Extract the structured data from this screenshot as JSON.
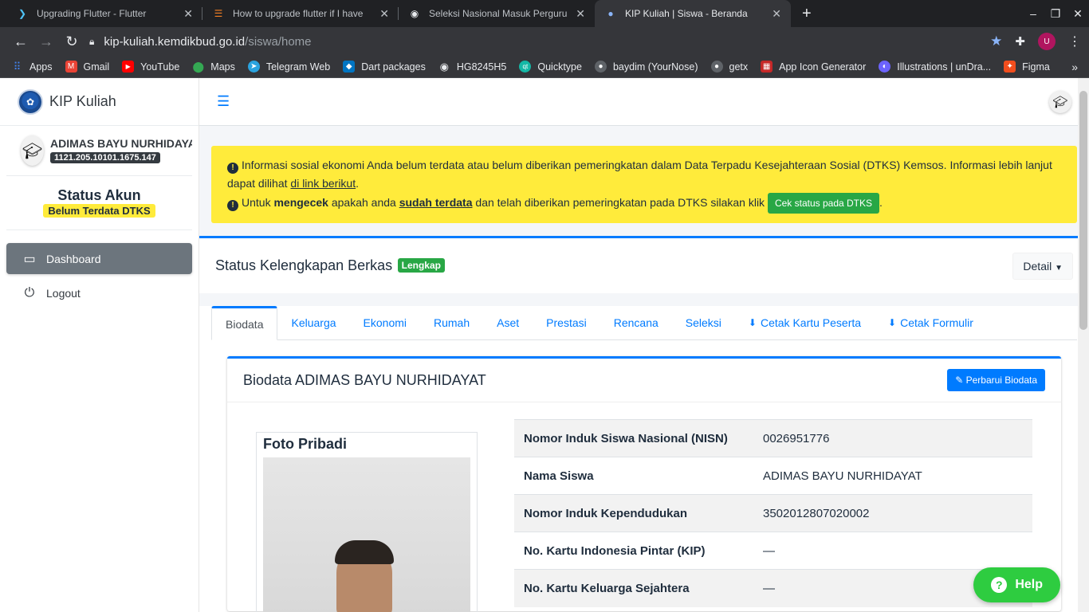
{
  "browser": {
    "tabs": [
      {
        "title": "Upgrading Flutter - Flutter",
        "icon": "flutter-icon",
        "color": "#4fc3f7"
      },
      {
        "title": "How to upgrade flutter if I have",
        "icon": "stackoverflow-icon",
        "color": "#f48024"
      },
      {
        "title": "Seleksi Nasional Masuk Perguru",
        "icon": "globe-icon",
        "color": "#e8eaed"
      },
      {
        "title": "KIP Kuliah | Siswa - Beranda",
        "icon": "kip-icon",
        "color": "#1e5bb0"
      }
    ],
    "url_host": "kip-kuliah.kemdikbud.go.id",
    "url_path": "/siswa/home",
    "profile_initial": "U",
    "bookmarks": [
      {
        "label": "Apps",
        "icon": "apps-icon",
        "color": "#4285f4"
      },
      {
        "label": "Gmail",
        "icon": "gmail-icon",
        "color": "#ea4335"
      },
      {
        "label": "YouTube",
        "icon": "youtube-icon",
        "color": "#ff0000"
      },
      {
        "label": "Maps",
        "icon": "maps-icon",
        "color": "#34a853"
      },
      {
        "label": "Telegram Web",
        "icon": "telegram-icon",
        "color": "#2aa3df"
      },
      {
        "label": "Dart packages",
        "icon": "dart-icon",
        "color": "#0175c2"
      },
      {
        "label": "HG8245H5",
        "icon": "globe-icon",
        "color": "#5f6368"
      },
      {
        "label": "Quicktype",
        "icon": "quicktype-icon",
        "color": "#14b8a6"
      },
      {
        "label": "baydim (YourNose)",
        "icon": "github-icon",
        "color": "#5f6368"
      },
      {
        "label": "getx",
        "icon": "github-icon",
        "color": "#5f6368"
      },
      {
        "label": "App Icon Generator",
        "icon": "app-icon-generator-icon",
        "color": "#c62828"
      },
      {
        "label": "Illustrations | unDra...",
        "icon": "undraw-icon",
        "color": "#6c63ff"
      },
      {
        "label": "Figma",
        "icon": "figma-icon",
        "color": "#f24e1e"
      }
    ]
  },
  "sidebar": {
    "brand": "KIP Kuliah",
    "user_name": "ADIMAS BAYU NURHIDAYAT",
    "user_id": "1121.205.10101.1675.147",
    "status_title": "Status Akun",
    "status_badge": "Belum Terdata DTKS",
    "nav": [
      {
        "label": "Dashboard",
        "icon": "dashboard-icon",
        "active": true
      },
      {
        "label": "Logout",
        "icon": "power-icon",
        "active": false
      }
    ]
  },
  "alert": {
    "line1": "Informasi sosial ekonomi Anda belum terdata atau belum diberikan pemeringkatan dalam Data Terpadu Kesejahteraan Sosial (DTKS) Kemsos. Informasi lebih lanjut dapat dilihat ",
    "line1_link": "di link berikut",
    "line2_a": "Untuk ",
    "line2_b": "mengecek",
    "line2_c": " apakah anda ",
    "line2_d": "sudah terdata",
    "line2_e": " dan telah diberikan pemeringkatan pada DTKS silakan klik ",
    "button": "Cek status pada DTKS",
    "color": "#ffeb3b"
  },
  "kelengkapan": {
    "title": "Status Kelengkapan Berkas",
    "badge": "Lengkap",
    "detail": "Detail"
  },
  "tabs": [
    "Biodata",
    "Keluarga",
    "Ekonomi",
    "Rumah",
    "Aset",
    "Prestasi",
    "Rencana",
    "Seleksi",
    "Cetak Kartu Peserta",
    "Cetak Formulir"
  ],
  "biodata": {
    "title": "Biodata ADIMAS BAYU NURHIDAYAT",
    "update_button": "Perbarui Biodata",
    "photo_title": "Foto Pribadi",
    "rows": [
      {
        "key": "Nomor Induk Siswa Nasional (NISN)",
        "value": "0026951776"
      },
      {
        "key": "Nama Siswa",
        "value": "ADIMAS BAYU NURHIDAYAT"
      },
      {
        "key": "Nomor Induk Kependudukan",
        "value": "3502012807020002"
      },
      {
        "key": "No. Kartu Indonesia Pintar (KIP)",
        "value": "—"
      },
      {
        "key": "No. Kartu Keluarga Sejahtera",
        "value": "—"
      }
    ]
  },
  "help": "Help",
  "accent": "#007bff"
}
